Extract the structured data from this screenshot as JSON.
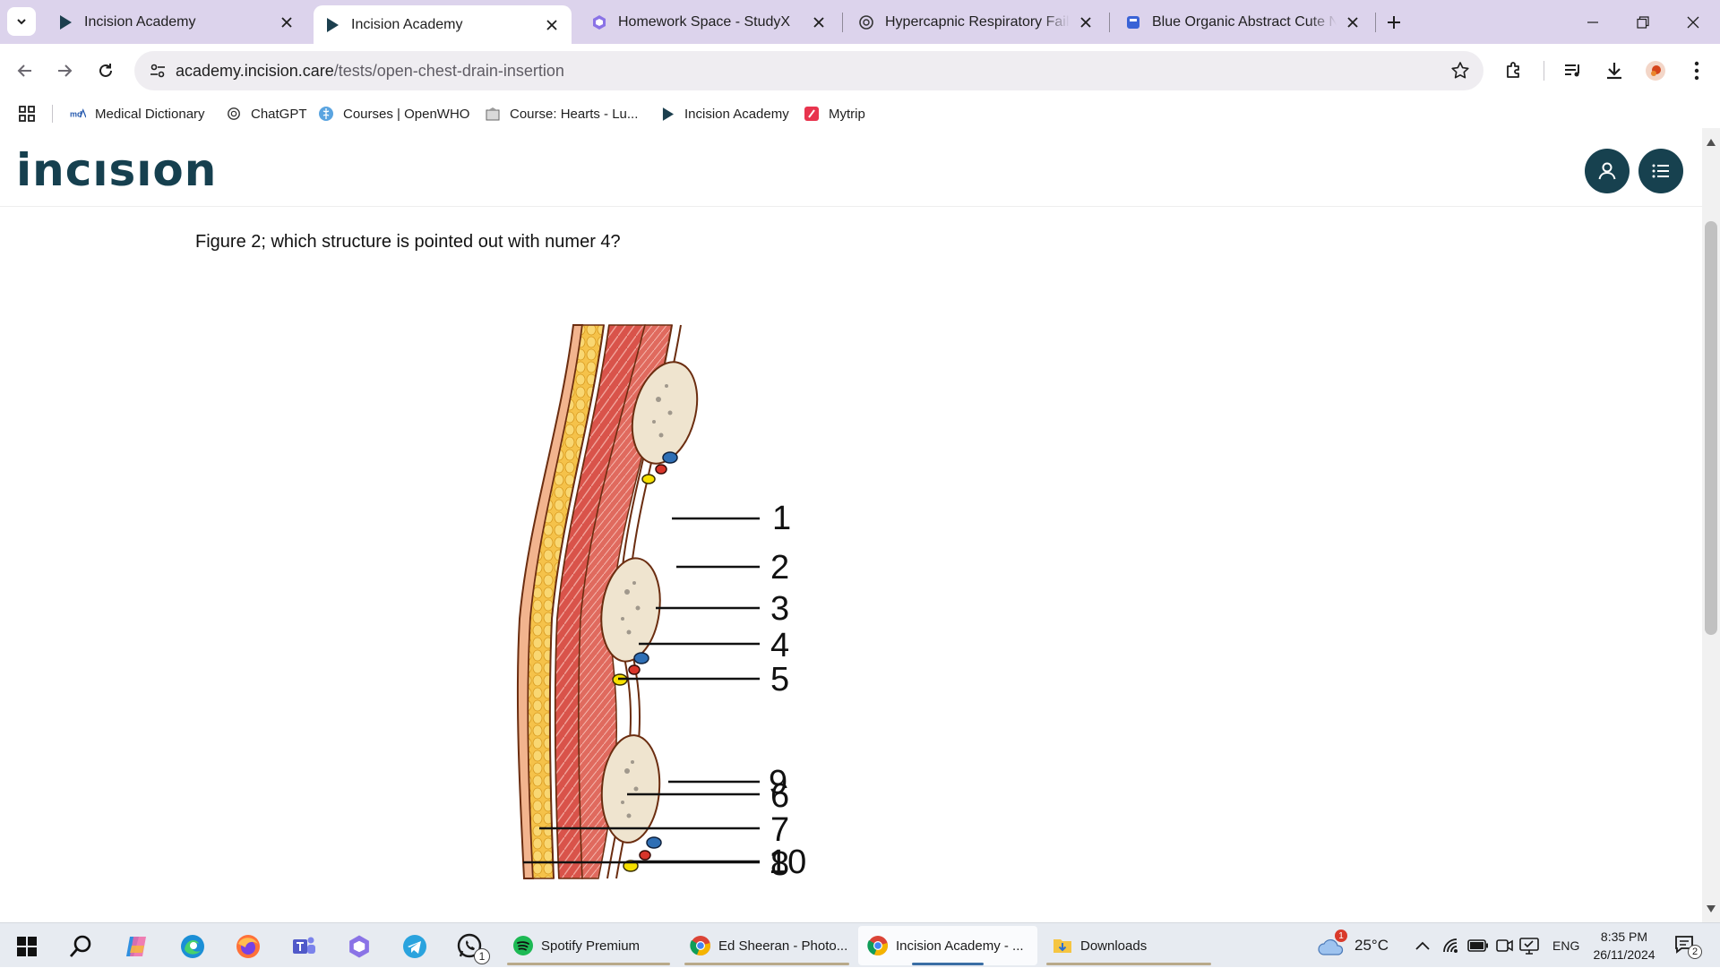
{
  "tabs": [
    {
      "title": "Incision Academy",
      "icon": "play-triangle-icon",
      "active": false
    },
    {
      "title": "Incision Academy",
      "icon": "play-triangle-icon",
      "active": true
    },
    {
      "title": "Homework Space - StudyX",
      "icon": "studyx-icon",
      "active": false
    },
    {
      "title": "Hypercapnic Respiratory Failure",
      "icon": "chatgpt-icon",
      "active": false
    },
    {
      "title": "Blue Organic Abstract Cute Not",
      "icon": "canva-icon",
      "active": false
    }
  ],
  "address_bar": {
    "domain": "academy.incision.care",
    "path": "/tests/open-chest-drain-insertion"
  },
  "bookmarks": [
    {
      "label": "Medical Dictionary",
      "icon": "dictionary-icon"
    },
    {
      "label": "ChatGPT",
      "icon": "chatgpt-icon"
    },
    {
      "label": "Courses | OpenWHO",
      "icon": "who-icon"
    },
    {
      "label": "Course: Hearts - Lu...",
      "icon": "course-icon"
    },
    {
      "label": "Incision Academy",
      "icon": "play-triangle-icon"
    },
    {
      "label": "Mytrip",
      "icon": "mytrip-icon"
    }
  ],
  "site": {
    "logo_text": "incısıon",
    "brand_color": "#17414f"
  },
  "question": {
    "text": "Figure 2; which structure is pointed out with numer 4?"
  },
  "figure": {
    "labels": [
      "1",
      "2",
      "3",
      "4",
      "5",
      "6",
      "7",
      "8",
      "9",
      "10"
    ]
  },
  "taskbar": {
    "tasks": [
      {
        "label": "Spotify Premium",
        "icon": "spotify-icon"
      },
      {
        "label": "Ed Sheeran - Photo...",
        "icon": "chrome-icon"
      },
      {
        "label": "Incision Academy - ...",
        "icon": "chrome-icon"
      },
      {
        "label": "Downloads",
        "icon": "folder-icon"
      }
    ],
    "whatsapp_badge": "1",
    "weather_badge": "1",
    "temperature": "25°C",
    "language": "ENG",
    "time": "8:35 PM",
    "date": "26/11/2024",
    "notification_count": "2"
  }
}
